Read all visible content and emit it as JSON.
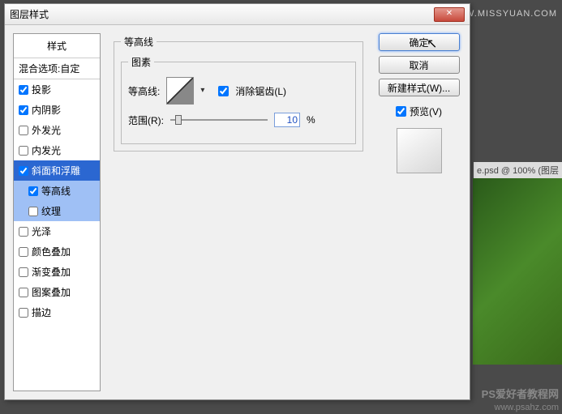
{
  "titlebar": {
    "title": "图层样式"
  },
  "source": "思缘设计论坛  WWW.MISSYUAN.COM",
  "sidebar": {
    "header": "样式",
    "items": [
      {
        "label": "混合选项:自定",
        "checked": null,
        "section": true
      },
      {
        "label": "投影",
        "checked": true
      },
      {
        "label": "内阴影",
        "checked": true
      },
      {
        "label": "外发光",
        "checked": false
      },
      {
        "label": "内发光",
        "checked": false
      },
      {
        "label": "斜面和浮雕",
        "checked": true,
        "selected": true
      },
      {
        "label": "等高线",
        "checked": true,
        "sub": true,
        "subselected": true
      },
      {
        "label": "纹理",
        "checked": false,
        "sub": true,
        "subselected": true
      },
      {
        "label": "光泽",
        "checked": false
      },
      {
        "label": "颜色叠加",
        "checked": false
      },
      {
        "label": "渐变叠加",
        "checked": false
      },
      {
        "label": "图案叠加",
        "checked": false
      },
      {
        "label": "描边",
        "checked": false
      }
    ]
  },
  "content": {
    "group_title": "等高线",
    "subgroup_title": "图素",
    "contour_label": "等高线:",
    "antialias_label": "消除锯齿(L)",
    "antialias_checked": true,
    "range_label": "范围(R):",
    "range_value": "10",
    "range_unit": "%"
  },
  "buttons": {
    "ok": "确定",
    "cancel": "取消",
    "new_style": "新建样式(W)...",
    "preview_label": "预览(V)",
    "preview_checked": true
  },
  "bg": {
    "tab": "e.psd @ 100% (图层"
  },
  "watermark": {
    "line1": "PS爱好者教程网",
    "line2": "www.psahz.com"
  }
}
